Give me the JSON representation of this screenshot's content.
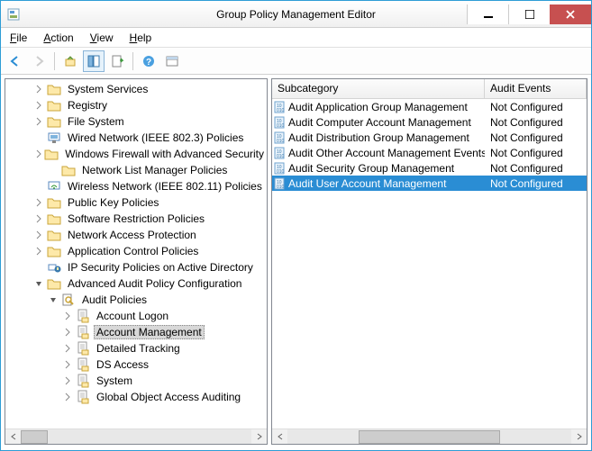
{
  "window": {
    "title": "Group Policy Management Editor"
  },
  "menu": {
    "file": "File",
    "action": "Action",
    "view": "View",
    "help": "Help"
  },
  "tree": {
    "items": [
      {
        "label": "System Services",
        "icon": "folder",
        "indent": 2,
        "twisty": "closed"
      },
      {
        "label": "Registry",
        "icon": "folder",
        "indent": 2,
        "twisty": "closed"
      },
      {
        "label": "File System",
        "icon": "folder",
        "indent": 2,
        "twisty": "closed"
      },
      {
        "label": "Wired Network (IEEE 802.3) Policies",
        "icon": "wired",
        "indent": 2,
        "twisty": "none"
      },
      {
        "label": "Windows Firewall with Advanced Security",
        "icon": "folder",
        "indent": 2,
        "twisty": "closed"
      },
      {
        "label": "Network List Manager Policies",
        "icon": "folder",
        "indent": 3,
        "twisty": "none"
      },
      {
        "label": "Wireless Network (IEEE 802.11) Policies",
        "icon": "wireless",
        "indent": 2,
        "twisty": "none"
      },
      {
        "label": "Public Key Policies",
        "icon": "folder",
        "indent": 2,
        "twisty": "closed"
      },
      {
        "label": "Software Restriction Policies",
        "icon": "folder",
        "indent": 2,
        "twisty": "closed"
      },
      {
        "label": "Network Access Protection",
        "icon": "folder",
        "indent": 2,
        "twisty": "closed"
      },
      {
        "label": "Application Control Policies",
        "icon": "folder",
        "indent": 2,
        "twisty": "closed"
      },
      {
        "label": "IP Security Policies on Active Directory",
        "icon": "ipsec",
        "indent": 2,
        "twisty": "none"
      },
      {
        "label": "Advanced Audit Policy Configuration",
        "icon": "folder",
        "indent": 2,
        "twisty": "open"
      },
      {
        "label": "Audit Policies",
        "icon": "audit",
        "indent": 3,
        "twisty": "open"
      },
      {
        "label": "Account Logon",
        "icon": "doc",
        "indent": 4,
        "twisty": "closed"
      },
      {
        "label": "Account Management",
        "icon": "doc",
        "indent": 4,
        "twisty": "closed",
        "selected": true
      },
      {
        "label": "Detailed Tracking",
        "icon": "doc",
        "indent": 4,
        "twisty": "closed"
      },
      {
        "label": "DS Access",
        "icon": "doc",
        "indent": 4,
        "twisty": "closed"
      },
      {
        "label": "System",
        "icon": "doc",
        "indent": 4,
        "twisty": "closed"
      },
      {
        "label": "Global Object Access Auditing",
        "icon": "doc",
        "indent": 4,
        "twisty": "closed"
      }
    ]
  },
  "list": {
    "header_sub": "Subcategory",
    "header_audit": "Audit Events",
    "rows": [
      {
        "sub": "Audit Application Group Management",
        "aud": "Not Configured"
      },
      {
        "sub": "Audit Computer Account Management",
        "aud": "Not Configured"
      },
      {
        "sub": "Audit Distribution Group Management",
        "aud": "Not Configured"
      },
      {
        "sub": "Audit Other Account Management Events",
        "aud": "Not Configured"
      },
      {
        "sub": "Audit Security Group Management",
        "aud": "Not Configured"
      },
      {
        "sub": "Audit User Account Management",
        "aud": "Not Configured",
        "selected": true
      }
    ]
  }
}
